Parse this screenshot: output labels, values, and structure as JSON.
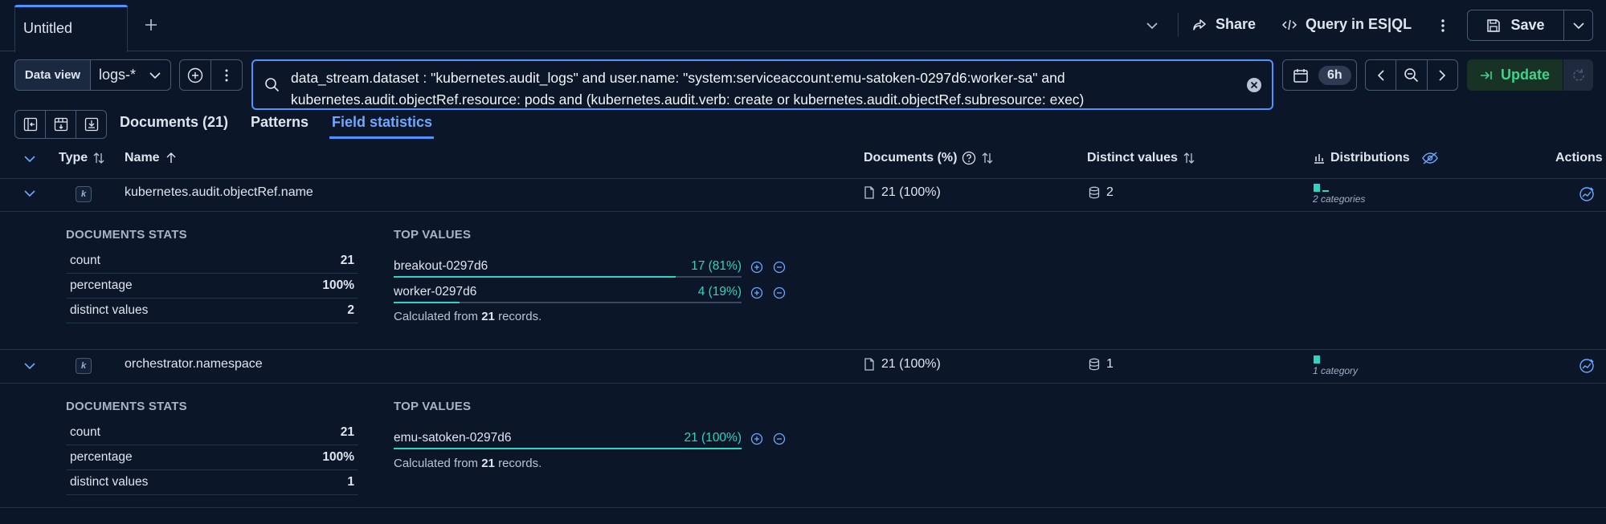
{
  "topbar": {
    "tab_title": "Untitled",
    "share_label": "Share",
    "esql_label": "Query in ES|QL",
    "save_label": "Save"
  },
  "query": {
    "dataview_label": "Data view",
    "dataview_value": "logs-*",
    "text": "data_stream.dataset : \"kubernetes.audit_logs\" and user.name: \"system:serviceaccount:emu-satoken-0297d6:worker-sa\" and kubernetes.audit.objectRef.resource: pods and (kubernetes.audit.verb: create or kubernetes.audit.objectRef.subresource: exec)",
    "time_badge": "6h",
    "update_label": "Update"
  },
  "views": {
    "documents": "Documents (21)",
    "patterns": "Patterns",
    "field_statistics": "Field statistics"
  },
  "table": {
    "headers": {
      "type": "Type",
      "name": "Name",
      "documents": "Documents (%)",
      "distinct": "Distinct values",
      "distributions": "Distributions",
      "actions": "Actions"
    },
    "rows": [
      {
        "type": "k",
        "name": "kubernetes.audit.objectRef.name",
        "documents": "21 (100%)",
        "distinct": "2",
        "distribution_label": "2 categories",
        "stats_title": "DOCUMENTS STATS",
        "stats": [
          {
            "label": "count",
            "value": "21"
          },
          {
            "label": "percentage",
            "value": "100%"
          },
          {
            "label": "distinct values",
            "value": "2"
          }
        ],
        "top_title": "TOP VALUES",
        "top_values": [
          {
            "label": "breakout-0297d6",
            "pct": "17 (81%)",
            "fraction": 0.81
          },
          {
            "label": "worker-0297d6",
            "pct": "4 (19%)",
            "fraction": 0.19
          }
        ],
        "calc_prefix": "Calculated from",
        "calc_count": "21",
        "calc_suffix": "records."
      },
      {
        "type": "k",
        "name": "orchestrator.namespace",
        "documents": "21 (100%)",
        "distinct": "1",
        "distribution_label": "1 category",
        "stats_title": "DOCUMENTS STATS",
        "stats": [
          {
            "label": "count",
            "value": "21"
          },
          {
            "label": "percentage",
            "value": "100%"
          },
          {
            "label": "distinct values",
            "value": "1"
          }
        ],
        "top_title": "TOP VALUES",
        "top_values": [
          {
            "label": "emu-satoken-0297d6",
            "pct": "21 (100%)",
            "fraction": 1.0
          }
        ],
        "calc_prefix": "Calculated from",
        "calc_count": "21",
        "calc_suffix": "records."
      }
    ]
  },
  "colors": {
    "background": "#0b1628",
    "accent": "#4d94ff",
    "teal": "#2dd4bf",
    "update_green": "#3fd38a"
  }
}
